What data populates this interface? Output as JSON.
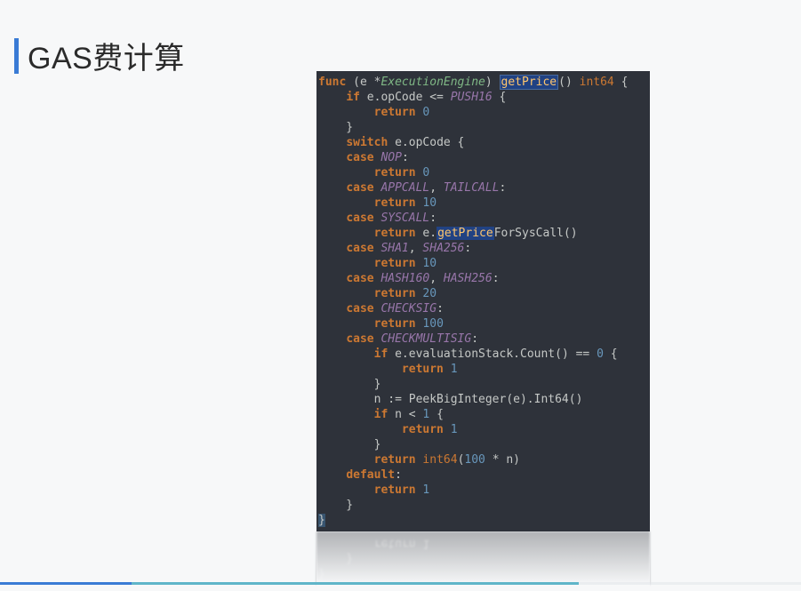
{
  "title": "GAS费计算",
  "code": {
    "l00": "func",
    "l00_e": " (e *",
    "l00_t": "ExecutionEngine",
    "l00_p": ") ",
    "l00_fn": "getPrice",
    "l00_end": "() ",
    "l00_ret": "int64",
    "l00_br": " {",
    "l01_a": "    ",
    "l01_kw": "if",
    "l01_b": " e.opCode <= ",
    "l01_c": "PUSH16",
    "l01_d": " {",
    "l02_a": "        ",
    "l02_kw": "return",
    "l02_b": " ",
    "l02_n": "0",
    "l03": "    }",
    "l04_a": "    ",
    "l04_kw": "switch",
    "l04_b": " e.opCode {",
    "l05_a": "    ",
    "l05_kw": "case",
    "l05_b": " ",
    "l05_c": "NOP",
    "l05_d": ":",
    "l06_a": "        ",
    "l06_kw": "return",
    "l06_b": " ",
    "l06_n": "0",
    "l07_a": "    ",
    "l07_kw": "case",
    "l07_b": " ",
    "l07_c": "APPCALL",
    "l07_d": ", ",
    "l07_e": "TAILCALL",
    "l07_f": ":",
    "l08_a": "        ",
    "l08_kw": "return",
    "l08_b": " ",
    "l08_n": "10",
    "l09_a": "    ",
    "l09_kw": "case",
    "l09_b": " ",
    "l09_c": "SYSCALL",
    "l09_d": ":",
    "l10_a": "        ",
    "l10_kw": "return",
    "l10_b": " e.",
    "l10_fn": "getPrice",
    "l10_c": "ForSysCall()",
    "l11_a": "    ",
    "l11_kw": "case",
    "l11_b": " ",
    "l11_c": "SHA1",
    "l11_d": ", ",
    "l11_e": "SHA256",
    "l11_f": ":",
    "l12_a": "        ",
    "l12_kw": "return",
    "l12_b": " ",
    "l12_n": "10",
    "l13_a": "    ",
    "l13_kw": "case",
    "l13_b": " ",
    "l13_c": "HASH160",
    "l13_d": ", ",
    "l13_e": "HASH256",
    "l13_f": ":",
    "l14_a": "        ",
    "l14_kw": "return",
    "l14_b": " ",
    "l14_n": "20",
    "l15_a": "    ",
    "l15_kw": "case",
    "l15_b": " ",
    "l15_c": "CHECKSIG",
    "l15_d": ":",
    "l16_a": "        ",
    "l16_kw": "return",
    "l16_b": " ",
    "l16_n": "100",
    "l17_a": "    ",
    "l17_kw": "case",
    "l17_b": " ",
    "l17_c": "CHECKMULTISIG",
    "l17_d": ":",
    "l18_a": "        ",
    "l18_kw": "if",
    "l18_b": " e.evaluationStack.Count() == ",
    "l18_n": "0",
    "l18_c": " {",
    "l19_a": "            ",
    "l19_kw": "return",
    "l19_b": " ",
    "l19_n": "1",
    "l20": "        }",
    "l21_a": "        n := PeekBigInteger(e).Int64()",
    "l22_a": "        ",
    "l22_kw": "if",
    "l22_b": " n < ",
    "l22_n": "1",
    "l22_c": " {",
    "l23_a": "            ",
    "l23_kw": "return",
    "l23_b": " ",
    "l23_n": "1",
    "l24": "        }",
    "l25_a": "        ",
    "l25_kw": "return",
    "l25_b": " ",
    "l25_t": "int64",
    "l25_c": "(",
    "l25_n": "100",
    "l25_d": " * n)",
    "l26_a": "    ",
    "l26_kw": "default",
    "l26_b": ":",
    "l27_a": "        ",
    "l27_kw": "return",
    "l27_b": " ",
    "l27_n": "1",
    "l28": "    }",
    "l29": "}"
  },
  "reflection": {
    "r1": "        return 1",
    "r2": "    }",
    "r3": "}"
  }
}
